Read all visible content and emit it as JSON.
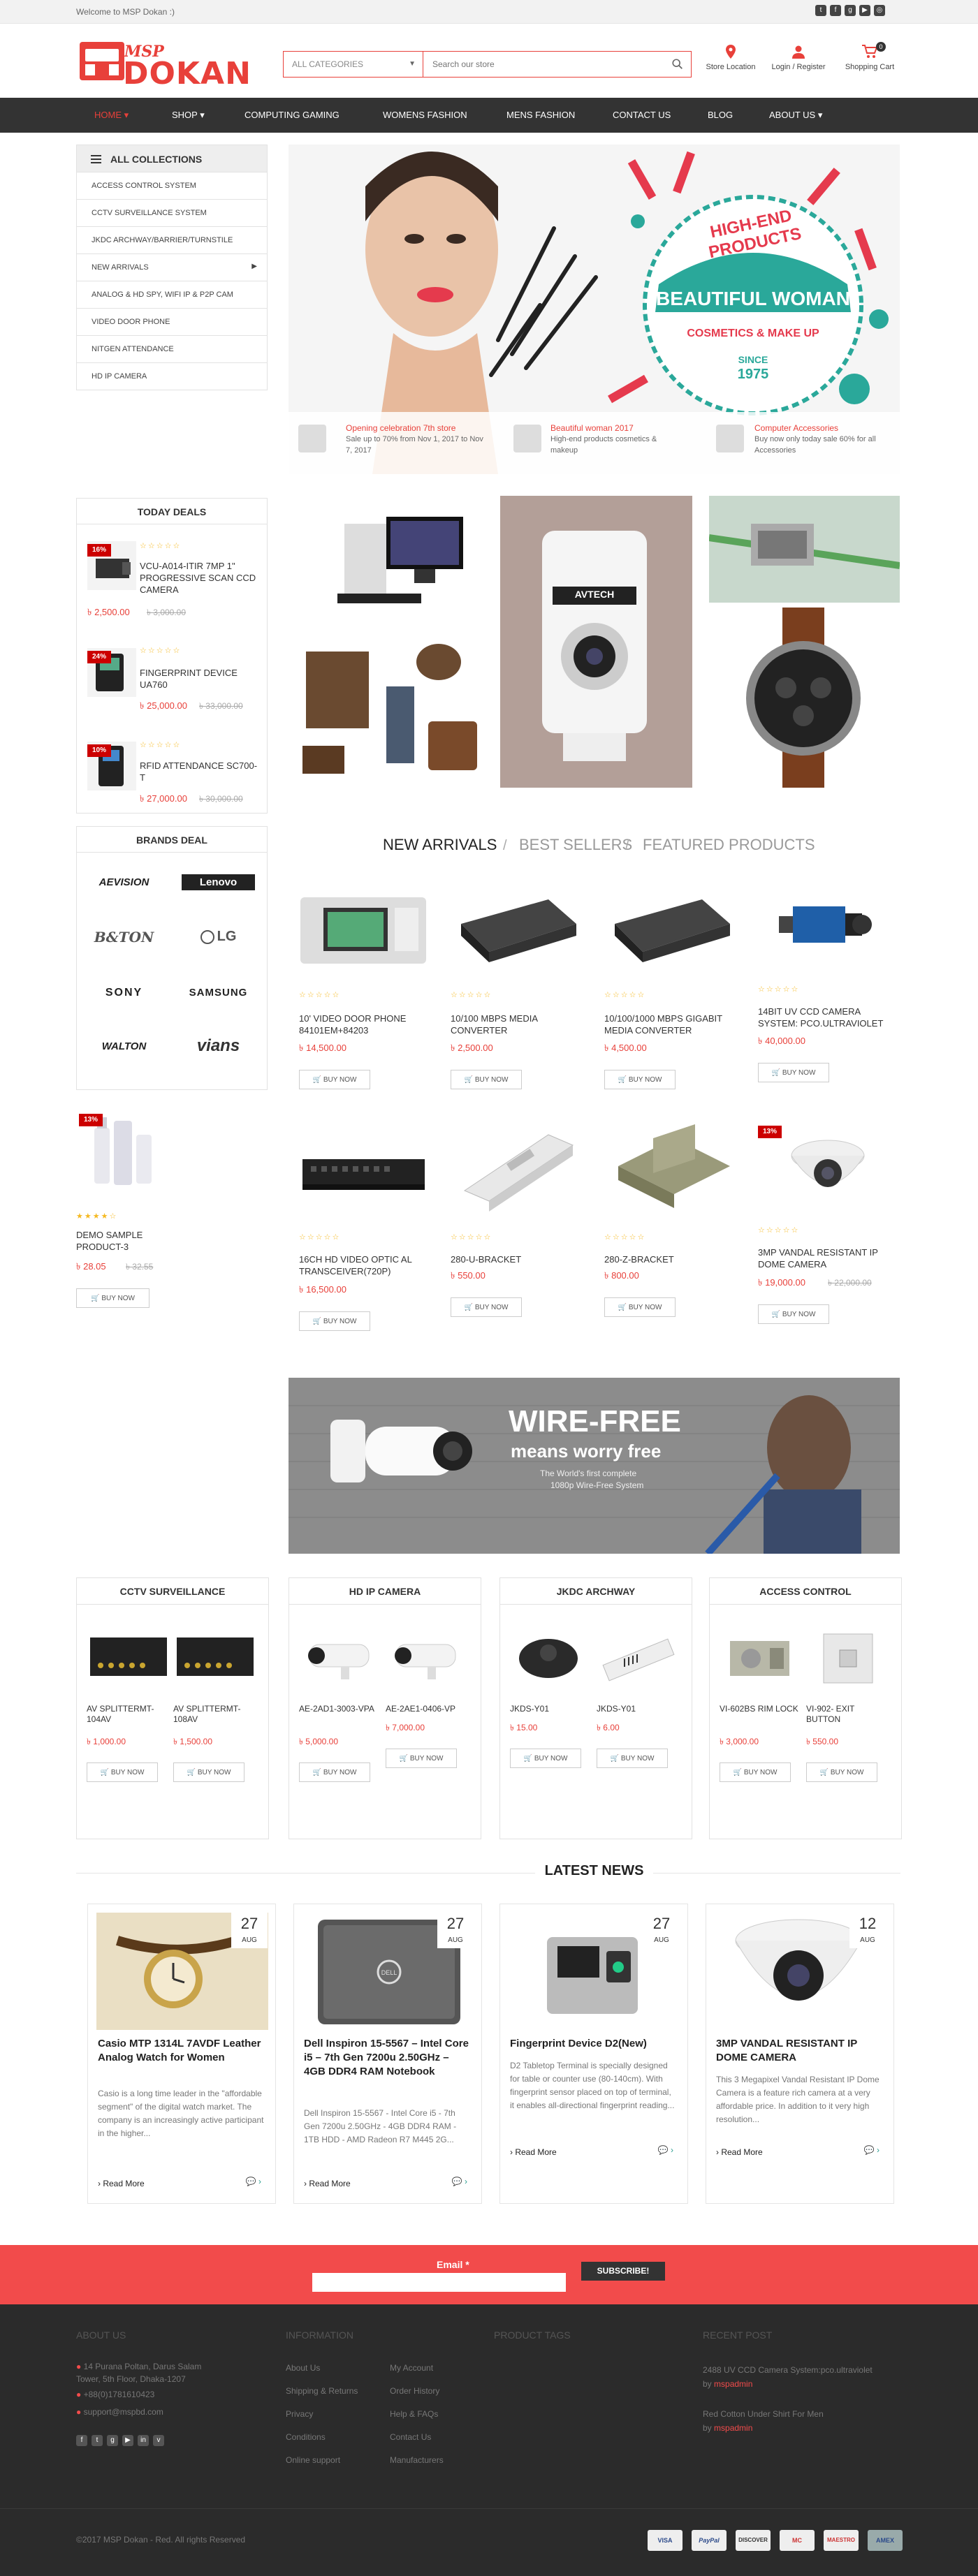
{
  "topbar": {
    "welcome": "Welcome to MSP Dokan :)"
  },
  "header": {
    "logo_top": "MSP",
    "logo_main": "DOKAN",
    "category_label": "ALL CATEGORIES",
    "search_placeholder": "Search our store",
    "store_location": "Store Location",
    "login_register": "Login / Register",
    "shopping_cart": "Shopping Cart",
    "cart_count": "0"
  },
  "nav": [
    "HOME",
    "SHOP",
    "COMPUTING GAMING",
    "WOMENS FASHION",
    "MENS FASHION",
    "CONTACT US",
    "BLOG",
    "ABOUT US"
  ],
  "collections": {
    "title": "ALL COLLECTIONS",
    "items": [
      "Access Control System",
      "CCTV Surveillance System",
      "JKDC ARCHWAY/BARRIER/TURNSTILE",
      "NEW ARRIVALS",
      "ANALOG & HD SPY, WIFI IP & P2P CAM",
      "VIDEO DOOR PHONE",
      "NITGEN ATTENDANCE",
      "HD IP CAMERA"
    ]
  },
  "hero": {
    "badge_line1": "HIGH-END PRODUCTS",
    "badge_line2": "BEAUTIFUL WOMAN",
    "badge_line3": "COSMETICS & MAKE UP",
    "badge_since": "SINCE",
    "badge_year": "1975",
    "items": [
      {
        "title": "Opening celebration 7th store",
        "text": "Sale up to 70% from Nov 1, 2017 to Nov 7, 2017"
      },
      {
        "title": "Beautiful woman 2017",
        "text": "High-end products cosmetics & makeup"
      },
      {
        "title": "Computer Accessories",
        "text": "Buy now only today sale 60% for all Accessories"
      }
    ]
  },
  "today_deals": {
    "title": "TODAY DEALS",
    "items": [
      {
        "badge": "16%",
        "name": "VCU-A014-ITIR 7MP 1\" PROGRESSIVE SCAN CCD CAMERA",
        "price": "৳ 2,500.00",
        "old": "৳ 3,000.00"
      },
      {
        "badge": "24%",
        "name": "FINGERPRINT DEVICE UA760",
        "price": "৳ 25,000.00",
        "old": "৳ 33,000.00"
      },
      {
        "badge": "10%",
        "name": "RFID ATTENDANCE SC700-T",
        "price": "৳ 27,000.00",
        "old": "৳ 30,000.00"
      }
    ]
  },
  "brands": {
    "title": "BRANDS DEAL",
    "items": [
      "AEVISION",
      "Lenovo",
      "B&TON",
      "LG",
      "SONY",
      "SAMSUNG",
      "WALTON",
      "vians"
    ]
  },
  "demo_product": {
    "badge": "13%",
    "name": "DEMO SAMPLE PRODUCT-3",
    "price": "৳ 28.05",
    "old": "৳ 32.55",
    "buy": "BUY NOW"
  },
  "product_tabs": [
    "NEW ARRIVALS",
    "BEST SELLERS",
    "FEATURED PRODUCTS"
  ],
  "products": [
    {
      "name": "10' VIDEO DOOR PHONE 84101EM+84203",
      "price": "৳ 14,500.00",
      "old": "",
      "badge": ""
    },
    {
      "name": "10/100 MBPS MEDIA CONVERTER",
      "price": "৳ 2,500.00",
      "old": "",
      "badge": ""
    },
    {
      "name": "10/100/1000 MBPS GIGABIT MEDIA CONVERTER",
      "price": "৳ 4,500.00",
      "old": "",
      "badge": ""
    },
    {
      "name": "14BIT UV CCD CAMERA SYSTEM: PCO.ULTRAVIOLET",
      "price": "৳ 40,000.00",
      "old": "",
      "badge": ""
    },
    {
      "name": "16CH HD VIDEO OPTIC AL TRANSCEIVER(720P)",
      "price": "৳ 16,500.00",
      "old": "",
      "badge": ""
    },
    {
      "name": "280-U-BRACKET",
      "price": "৳ 550.00",
      "old": "",
      "badge": ""
    },
    {
      "name": "280-Z-BRACKET",
      "price": "৳ 800.00",
      "old": "",
      "badge": ""
    },
    {
      "name": "3MP VANDAL RESISTANT IP DOME CAMERA",
      "price": "৳ 19,000.00",
      "old": "৳ 22,000.00",
      "badge": "13%"
    }
  ],
  "buy_label": "BUY NOW",
  "wirefree": {
    "title": "WIRE-FREE",
    "subtitle": "means worry free",
    "line1": "The World's first complete",
    "line2": "1080p Wire-Free System"
  },
  "category_boxes": [
    {
      "title": "CCTV SURVEILLANCE",
      "items": [
        {
          "name": "AV SPLITTERMT-104AV",
          "price": "৳ 1,000.00"
        },
        {
          "name": "AV SPLITTERMT-108AV",
          "price": "৳ 1,500.00"
        }
      ]
    },
    {
      "title": "HD IP CAMERA",
      "items": [
        {
          "name": "AE-2AD1-3003-VPA",
          "price": "৳ 5,000.00"
        },
        {
          "name": "AE-2AE1-0406-VP",
          "price": "৳ 7,000.00"
        }
      ]
    },
    {
      "title": "JKDC ARCHWAY",
      "items": [
        {
          "name": "JKDS-Y01",
          "price": "৳ 15.00"
        },
        {
          "name": "JKDS-Y01",
          "price": "৳ 6.00"
        }
      ]
    },
    {
      "title": "ACCESS CONTROL",
      "items": [
        {
          "name": "VI-602BS RIM LOCK",
          "price": "৳ 3,000.00"
        },
        {
          "name": "VI-902- EXIT BUTTON",
          "price": "৳ 550.00"
        }
      ]
    }
  ],
  "news": {
    "title": "LATEST NEWS",
    "posts": [
      {
        "day": "27",
        "month": "AUG",
        "title": "Casio MTP 1314L 7AVDF Leather Analog Watch for Women",
        "body": "Casio is a long time leader in the \"affordable segment\" of the digital watch market. The company is an increasingly active participant in the higher...",
        "more": "Read More"
      },
      {
        "day": "27",
        "month": "AUG",
        "title": "Dell Inspiron 15-5567 – Intel Core i5 – 7th Gen 7200u 2.50GHz – 4GB DDR4 RAM Notebook",
        "body": "Dell Inspiron 15-5567 - Intel Core i5 - 7th Gen 7200u 2.50GHz - 4GB DDR4 RAM - 1TB HDD - AMD Radeon R7 M445 2G...",
        "more": "Read More"
      },
      {
        "day": "27",
        "month": "AUG",
        "title": "Fingerprint Device D2(New)",
        "body": "D2 Tabletop Terminal is specially designed for table or counter use (80-140cm). With fingerprint sensor placed on top of terminal, it enables all-directional fingerprint reading...",
        "more": "Read More"
      },
      {
        "day": "12",
        "month": "AUG",
        "title": "3MP VANDAL RESISTANT IP DOME CAMERA",
        "body": "This 3 Megapixel Vandal Resistant IP Dome Camera is a feature rich camera at a very affordable price. In addition to it very high resolution...",
        "more": "Read More"
      }
    ]
  },
  "newsletter": {
    "label": "Email *",
    "button": "SUBSCRIBE!"
  },
  "footer": {
    "about_title": "ABOUT US",
    "address": "14 Purana Poltan, Darus Salam Tower, 5th Floor, Dhaka-1207",
    "phone": "+88(0)1781610423",
    "email": "support@mspbd.com",
    "info_title": "INFORMATION",
    "info_col1": [
      "About Us",
      "Shipping & Returns",
      "Privacy",
      "Conditions",
      "Online support"
    ],
    "info_col2": [
      "My Account",
      "Order History",
      "Help & FAQs",
      "Contact Us",
      "Manufacturers"
    ],
    "tags_title": "PRODUCT TAGS",
    "recent_title": "RECENT POST",
    "recent_posts": [
      {
        "title": "2488 UV CCD Camera System:pco.ultraviolet",
        "by": "by",
        "author": "mspadmin"
      },
      {
        "title": "Red Cotton Under Shirt For Men",
        "by": "by",
        "author": "mspadmin"
      }
    ],
    "copyright": "©2017 MSP Dokan - Red. All rights Reserved",
    "payments": [
      "VISA",
      "PayPal",
      "DISCOVER",
      "MC",
      "MAESTRO",
      "AMEX"
    ]
  },
  "colors": {
    "accent": "#e8403a",
    "nav_bg": "#333333",
    "footer_bg": "#2b2b2b",
    "newsletter_bg": "#f24b4b",
    "star": "#f5b921"
  }
}
